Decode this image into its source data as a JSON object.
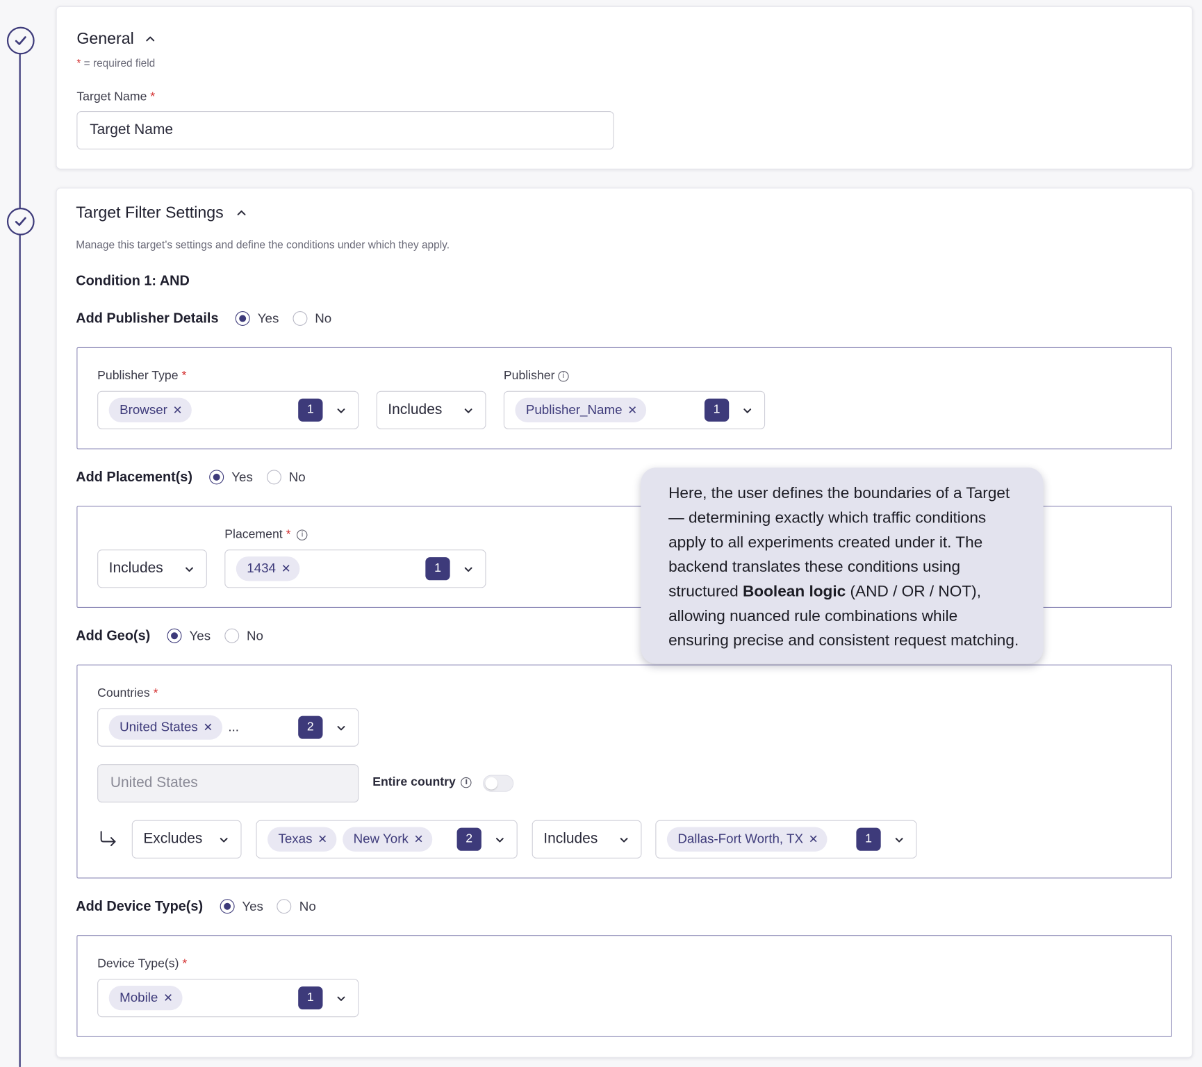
{
  "general": {
    "title": "General",
    "required_note": "= required field",
    "required_star": "*",
    "target_name_label": "Target Name",
    "target_name_value": "Target Name"
  },
  "filters": {
    "title": "Target Filter Settings",
    "description": "Manage this target’s settings and define the conditions under which they apply.",
    "condition_title": "Condition 1: AND",
    "yes_label": "Yes",
    "no_label": "No",
    "publisher": {
      "section_label": "Add Publisher Details",
      "type_label": "Publisher Type",
      "type_chips": [
        "Browser"
      ],
      "type_count": "1",
      "operator": "Includes",
      "publisher_label": "Publisher",
      "publisher_chips": [
        "Publisher_Name"
      ],
      "publisher_count": "1"
    },
    "placement": {
      "section_label": "Add Placement(s)",
      "operator": "Includes",
      "placement_label": "Placement",
      "chips": [
        "1434"
      ],
      "count": "1"
    },
    "geo": {
      "section_label": "Add Geo(s)",
      "countries_label": "Countries",
      "country_chips": [
        "United States"
      ],
      "overflow": "...",
      "country_count": "2",
      "country_field": "United States",
      "entire_country_label": "Entire country",
      "region_operator": "Excludes",
      "region_chips": [
        "Texas",
        "New York"
      ],
      "region_count": "2",
      "metro_operator": "Includes",
      "metro_chips": [
        "Dallas-Fort Worth, TX"
      ],
      "metro_count": "1"
    },
    "device": {
      "section_label": "Add Device Type(s)",
      "label": "Device Type(s)",
      "chips": [
        "Mobile"
      ],
      "count": "1"
    }
  },
  "tooltip": {
    "text_before": "Here, the user defines the boundaries of a Target — determining exactly which traffic conditions apply to all experiments created under it. The backend translates these conditions using structured ",
    "bold": "Boolean logic",
    "text_after": " (AND / OR / NOT), allowing nuanced rule combinations while ensuring precise and consistent request matching."
  },
  "colors": {
    "accent": "#3d3a7a",
    "chip_bg": "#e9e8f3",
    "required": "#d32f2f",
    "tooltip_bg": "#e3e3ee"
  }
}
